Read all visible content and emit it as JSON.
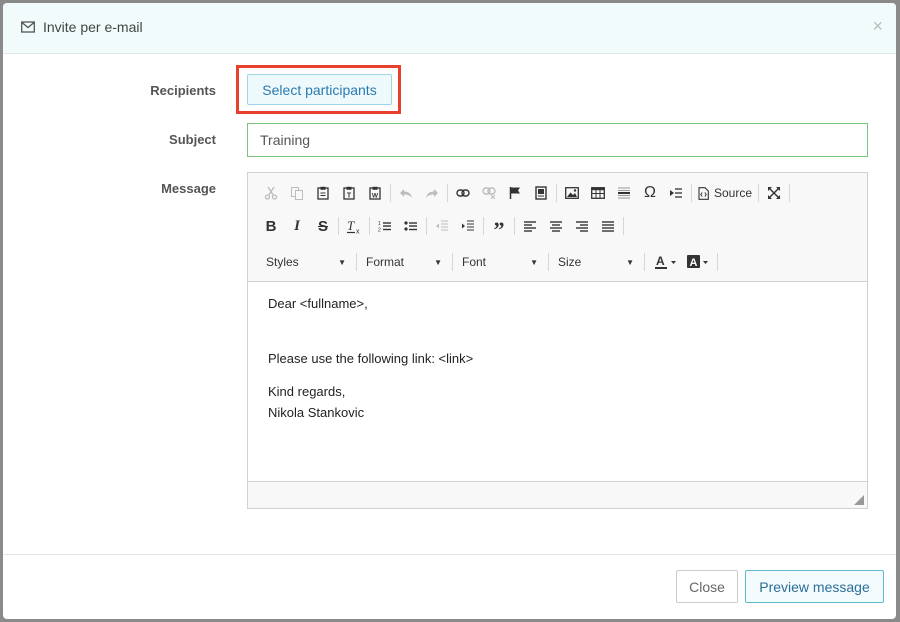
{
  "dialog": {
    "title": "Invite per e-mail",
    "close_glyph": "×"
  },
  "form": {
    "recipients_label": "Recipients",
    "select_participants_label": "Select participants",
    "subject_label": "Subject",
    "subject_value": "Training",
    "message_label": "Message"
  },
  "toolbar": {
    "source_label": "Source",
    "styles_label": "Styles",
    "format_label": "Format",
    "font_label": "Font",
    "size_label": "Size"
  },
  "message": {
    "line1": "Dear <fullname>,",
    "line2": "Please use the following link: <link>",
    "line3": "Kind regards,",
    "line4": "Nikola Stankovic"
  },
  "footer": {
    "close_label": "Close",
    "preview_label": "Preview message"
  },
  "colors": {
    "header_bg": "#f1fbfb",
    "highlight": "#e8402d",
    "subject_border": "#7cc47c",
    "accent": "#2a7ab0"
  }
}
